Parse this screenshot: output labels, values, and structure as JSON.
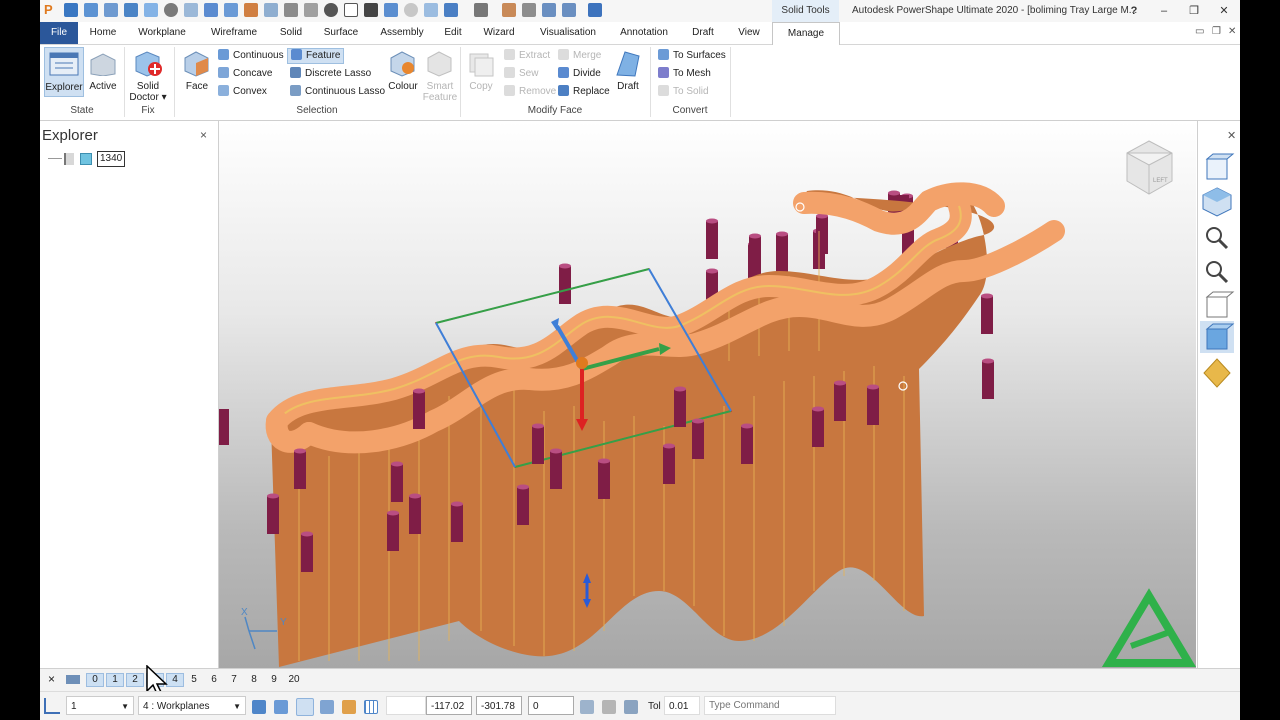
{
  "window": {
    "title": "Autodesk PowerShape Ultimate 2020 - [boliming Tray Large M...",
    "context_tab": "Solid Tools",
    "help_glyph": "?",
    "minimize_glyph": "–",
    "restore_glyph": "❐",
    "close_glyph": "✕",
    "app_logo": "P"
  },
  "tabs": [
    "File",
    "Home",
    "Workplane",
    "Wireframe",
    "Solid",
    "Surface",
    "Assembly",
    "Edit",
    "Wizard",
    "Visualisation",
    "Annotation",
    "Draft",
    "View",
    "Manage"
  ],
  "active_tab": "Manage",
  "ribbon": {
    "state": {
      "label": "State",
      "explorer": "Explorer",
      "active": "Active"
    },
    "fix": {
      "label": "Fix",
      "solid": "Solid",
      "doctor": "Doctor ▾"
    },
    "selection": {
      "label": "Selection",
      "face": "Face",
      "continuous": "Continuous",
      "concave": "Concave",
      "convex": "Convex",
      "feature": "Feature",
      "discrete_lasso": "Discrete Lasso",
      "continuous_lasso": "Continuous Lasso",
      "colour": "Colour",
      "smart": "Smart",
      "feature2": "Feature"
    },
    "modify_face": {
      "label": "Modify Face",
      "copy": "Copy",
      "extract": "Extract",
      "sew": "Sew",
      "remove": "Remove",
      "merge": "Merge",
      "divide": "Divide",
      "replace": "Replace",
      "draft": "Draft"
    },
    "convert": {
      "label": "Convert",
      "to_surfaces": "To Surfaces",
      "to_mesh": "To Mesh",
      "to_solid": "To Solid"
    }
  },
  "explorer": {
    "title": "Explorer",
    "close": "×",
    "tree_item": "1340"
  },
  "viewport": {
    "axis_x": "X",
    "axis_y": "Y",
    "view_cube_label": "LEFT",
    "part_color": "#c8773f",
    "top_color": "#f2a46c",
    "pin_color": "#8a1f4a",
    "brand_color": "#2fb14a"
  },
  "status_bar": {
    "close": "×",
    "levels": [
      "0",
      "1",
      "2",
      "3",
      "4",
      "5",
      "6",
      "7",
      "8",
      "9",
      "20"
    ],
    "levels_on": [
      "0",
      "1",
      "2",
      "3",
      "4"
    ],
    "workplane_select": "1",
    "level_select": "4   : Workplanes",
    "coord_x": "-117.02",
    "coord_y": "-301.78",
    "coord_z": "0",
    "tol_label": "Tol",
    "tol_value": "0.01",
    "command_placeholder": "Type Command"
  }
}
